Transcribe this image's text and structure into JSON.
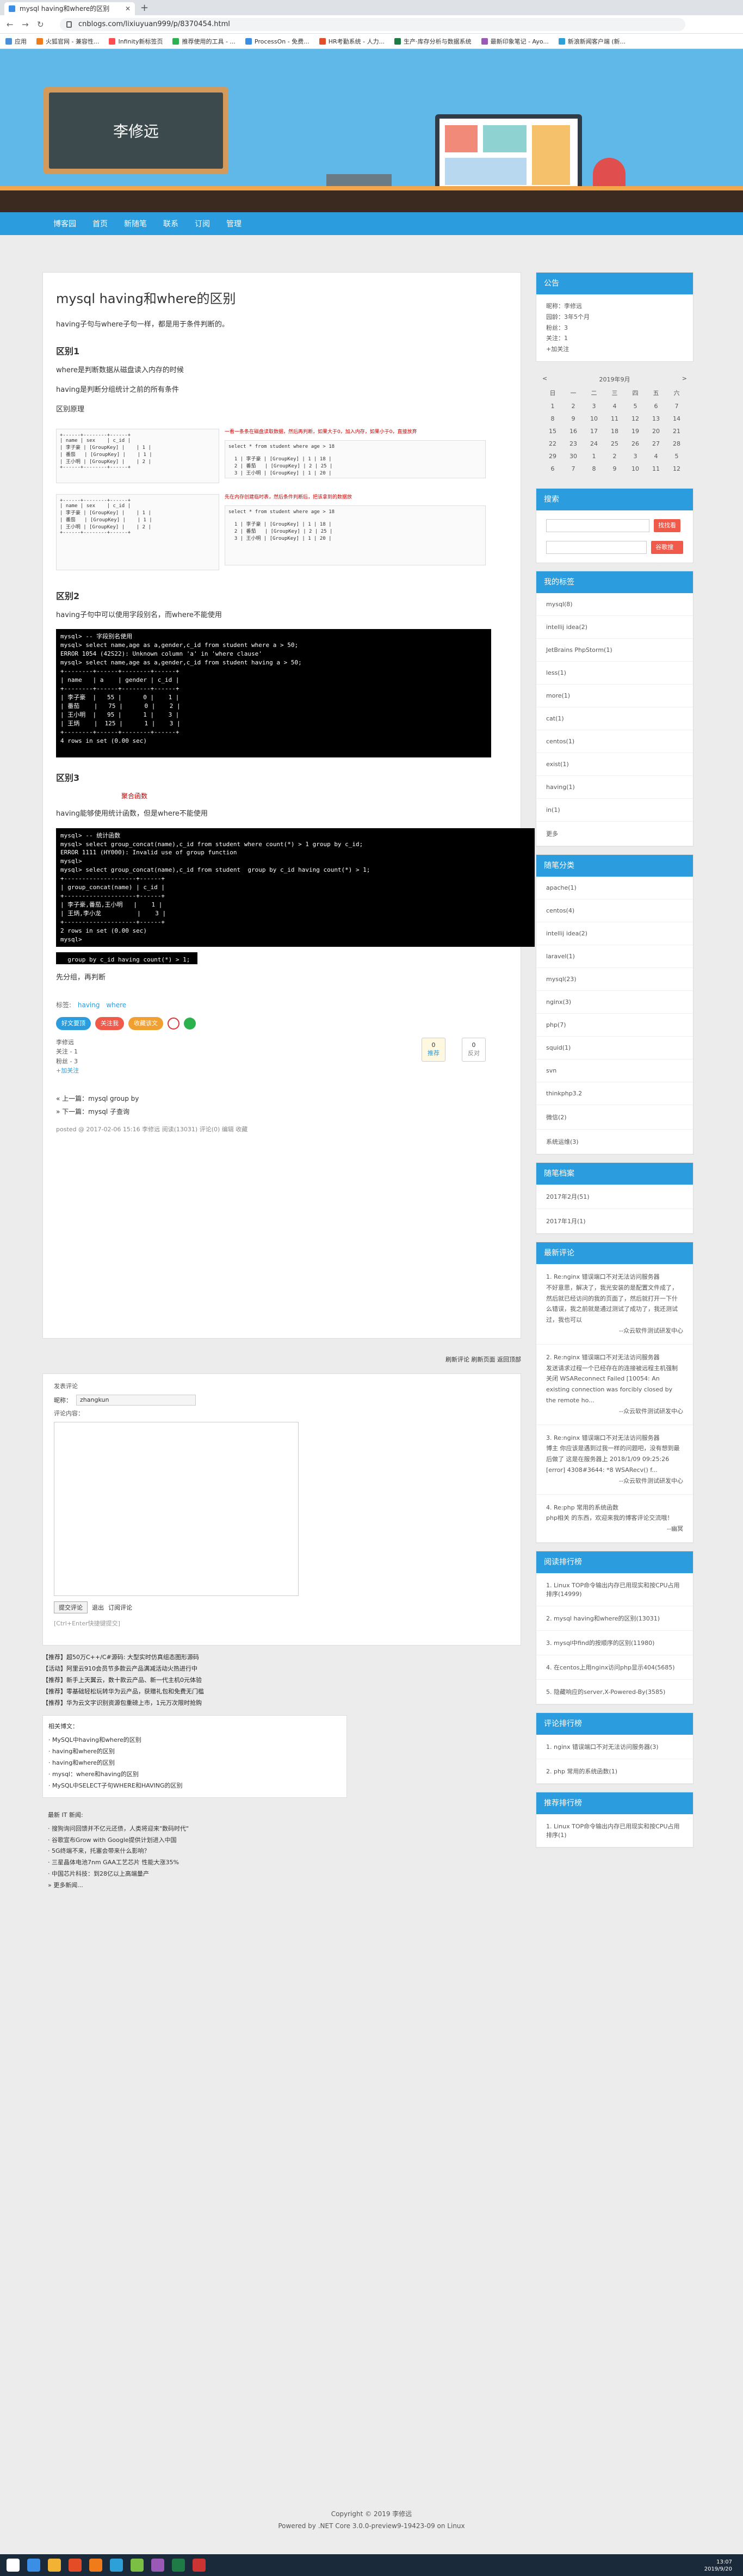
{
  "browser": {
    "tab_title": "mysql having和where的区别",
    "url": "cnblogs.com/lixiuyuan999/p/8370454.html",
    "bookmarks": [
      "应用",
      "火狐官网 - 兼容性...",
      "Infinity新标签页",
      "推荐使用的工具 - ...",
      "ProcessOn - 免费...",
      "HR考勤系统 - 人力...",
      "生产·库存分析与数据系统",
      "最新印象笔记 - Ayo...",
      "新浪新闻客户端 (新..."
    ]
  },
  "header": {
    "blog_name": "李修远"
  },
  "nav": [
    "博客园",
    "首页",
    "新随笔",
    "联系",
    "订阅",
    "管理"
  ],
  "post": {
    "title": "mysql having和where的区别",
    "intro": "having子句与where子句一样，都是用于条件判断的。",
    "s1_title": "区别1",
    "s1_p1": "where是判断数据从磁盘读入内存的时候",
    "s1_p2": "having是判断分组统计之前的所有条件",
    "s1_p3": "区别原理",
    "shot1_left": "+------+--------+------+\n| name | sex    | c_id |\n| 李子豪 | [GroupKey] |    | 1 |\n| 番茄   | [GroupKey] |    | 1 |\n| 王小明 | [GroupKey] |    | 2 |\n+------+--------+------+",
    "shot1_right": "select * from student where age > 18\n\n  1 | 李子豪 | [GroupKey] | 1 | 18 |\n  2 | 番茄   | [GroupKey] | 2 | 25 |\n  3 | 王小明 | [GroupKey] | 1 | 20 |",
    "shot1_caption": "一看一条条在磁盘读取数据，然后再判断，如果大于0，加入内存，如果小于0，直接放弃",
    "shot2_caption": "先在内存创建临时表，然后条件判断后，把该拿到的数据放",
    "s2_title": "区别2",
    "s2_p1": "having子句中可以使用字段别名，而where不能使用",
    "console1": "mysql> -- 字段别名使用\nmysql> select name,age as a,gender,c_id from student where a > 50;\nERROR 1054 (42S22): Unknown column 'a' in 'where clause'\nmysql> select name,age as a,gender,c_id from student having a > 50;\n+--------+------+--------+------+\n| name   | a    | gender | c_id |\n+--------+------+--------+------+\n| 李子豪  |   55 |      0 |    1 |\n| 番茄    |   75 |      0 |    2 |\n| 王小明  |   95 |      1 |    3 |\n| 王炳    |  125 |      1 |    3 |\n+--------+------+--------+------+\n4 rows in set (0.00 sec)",
    "s3_title": "区别3",
    "s3_note": "聚合函数",
    "s3_p1": "having能够使用统计函数，但是where不能使用",
    "console2": "mysql> -- 统计函数\nmysql> select group_concat(name),c_id from student where count(*) > 1 group by c_id;\nERROR 1111 (HY000): Invalid use of group function\nmysql>\nmysql> select group_concat(name),c_id from student  group by c_id having count(*) > 1;\n+--------------------+------+\n| group_concat(name) | c_id |\n+--------------------+------+\n| 李子豪,番茄,王小明   |    1 |\n| 王炳,李小龙          |    3 |\n+--------------------+------+\n2 rows in set (0.00 sec)\nmysql>",
    "console3": "  group by c_id having count(*) > 1;",
    "end_text": "先分组，再判断",
    "tags_label": "标签:",
    "tags": [
      "having",
      "where"
    ],
    "share": [
      "好文要顶",
      "关注我",
      "收藏该文"
    ],
    "author_line1": "李修远",
    "author_line2": "关注 - 1",
    "author_line3": "粉丝 - 3",
    "follow_btn": "+加关注",
    "upvote": "0",
    "downvote": "0",
    "upvote_label": "推荐",
    "downvote_label": "反对",
    "prev": "« 上一篇：mysql group by",
    "next": "» 下一篇：mysql 子查询",
    "meta": "posted @ 2017-02-06 15:16 李修远 阅读(13031) 评论(0) 编辑 收藏"
  },
  "comment": {
    "links": "刷新评论  刷新页面  返回顶部",
    "header": "发表评论",
    "nick_label": "昵称：",
    "nick_value": "zhangkun",
    "content_label": "评论内容：",
    "submit": "提交评论",
    "logout": "退出",
    "subscribe": "订阅评论",
    "hint": "[Ctrl+Enter快捷键提交]"
  },
  "ads": [
    "【推荐】超50万C++/C#源码: 大型实时仿真组态图形源码",
    "【活动】阿里云910会员节多款云产品满减活动火热进行中",
    "【推荐】新手上天翼云，数十款云产品、新一代主机0元体验",
    "【推荐】零基础轻松玩转华为云产品，获赠礼包和免费无门槛",
    "【推荐】华为云文字识别资源包重磅上市，1元万次限时抢购"
  ],
  "related": {
    "title": "相关博文：",
    "items": [
      "· MySQL中having和where的区别",
      "· having和where的区别",
      "· having和where的区别",
      "· mysql：where和having的区别",
      "· MySQL中SELECT子句WHERE和HAVING的区别"
    ]
  },
  "news": {
    "title": "最新 IT 新闻:",
    "items": [
      "· 搜狗询问回馈并不亿元还债，人类将迎来\"数码时代\"",
      "· 谷歌宣布Grow with Google提供计划进入中国",
      "· 5G终端不来，托塞会带来什么影响？",
      "· 三星晶体电池7nm GAA工艺芯片 性能大涨35%",
      "· 中国芯片科技：到28亿以上高端量产",
      "» 更多新闻..."
    ]
  },
  "sidebar": {
    "notice_title": "公告",
    "notice": [
      "昵称：李修远",
      "园龄：3年5个月",
      "粉丝：3",
      "关注：1",
      "+加关注"
    ],
    "calendar_title": "2019年9月",
    "cal_prev": "<",
    "cal_next": ">",
    "weekdays": [
      "日",
      "一",
      "二",
      "三",
      "四",
      "五",
      "六"
    ],
    "weeks": [
      [
        "1",
        "2",
        "3",
        "4",
        "5",
        "6",
        "7"
      ],
      [
        "8",
        "9",
        "10",
        "11",
        "12",
        "13",
        "14"
      ],
      [
        "15",
        "16",
        "17",
        "18",
        "19",
        "20",
        "21"
      ],
      [
        "22",
        "23",
        "24",
        "25",
        "26",
        "27",
        "28"
      ],
      [
        "29",
        "30",
        "1",
        "2",
        "3",
        "4",
        "5"
      ],
      [
        "6",
        "7",
        "8",
        "9",
        "10",
        "11",
        "12"
      ]
    ],
    "search_title": "搜索",
    "search_btn1": "找找看",
    "search_btn2": "谷歌搜索",
    "tags_title": "我的标签",
    "tags": [
      "mysql(8)",
      "intellij idea(2)",
      "JetBrains PhpStorm(1)",
      "less(1)",
      "more(1)",
      "cat(1)",
      "centos(1)",
      "exist(1)",
      "having(1)",
      "in(1)",
      "更多"
    ],
    "cats_title": "随笔分类",
    "cats": [
      "apache(1)",
      "centos(4)",
      "intellij idea(2)",
      "laravel(1)",
      "mysql(23)",
      "nginx(3)",
      "php(7)",
      "squid(1)",
      "svn",
      "thinkphp3.2",
      "微信(2)",
      "系统运维(3)"
    ],
    "archive_title": "随笔档案",
    "archive": [
      "2017年2月(51)",
      "2017年1月(1)"
    ],
    "comments_title": "最新评论",
    "comments": [
      {
        "title": "1. Re:nginx 错误端口不对无法访问服务器",
        "body": "不好意思，解决了，我光安装的是配置文件成了，然后就已经访问的我的页面了，然后就打开一下什么错误，我之前就是通过测试了成功了，我还测试过，我也可以",
        "author": "--众云软件测试研发中心"
      },
      {
        "title": "2. Re:nginx 错误端口不对无法访问服务器",
        "body": "发送请求过程一个已经存在的连接被远程主机强制关闭 WSAReconnect Failed [10054: An existing connection was forcibly closed by the remote ho...",
        "author": "--众云软件测试研发中心"
      },
      {
        "title": "3. Re:nginx 错误端口不对无法访问服务器",
        "body": "博主 你应该是遇到过我一样的问题吧，没有想到最后做了 这是在服务器上 2018/1/09 09:25:26 [error] 4308#3644: *8 WSARecv() f...",
        "author": "--众云软件测试研发中心"
      },
      {
        "title": "4. Re:php 常用的系统函数",
        "body": "php相关 的东西，欢迎来我的博客评论交流哦！",
        "author": "--幽冥"
      }
    ],
    "readrank_title": "阅读排行榜",
    "readrank": [
      "1. Linux TOP命令输出内存已用现实和按CPU占用排序(14999)",
      "2. mysql having和where的区别(13031)",
      "3. mysql中find的按顺序的区别(11980)",
      "4. 在centos上用nginx访问php显示404(5685)",
      "5. 隐藏响应的server,X-Powered-By(3585)"
    ],
    "commentrank_title": "评论排行榜",
    "commentrank": [
      "1. nginx 错误端口不对无法访问服务器(3)",
      "2. php 常用的系统函数(1)"
    ],
    "recrank_title": "推荐排行榜",
    "recrank": [
      "1. Linux TOP命令输出内存已用现实和按CPU占用排序(1)"
    ]
  },
  "footer": {
    "line1": "Copyright © 2019 李修远",
    "line2": "Powered by .NET Core 3.0.0-preview9-19423-09 on Linux"
  },
  "taskbar": {
    "time": "13:07",
    "date": "2019/9/20"
  }
}
